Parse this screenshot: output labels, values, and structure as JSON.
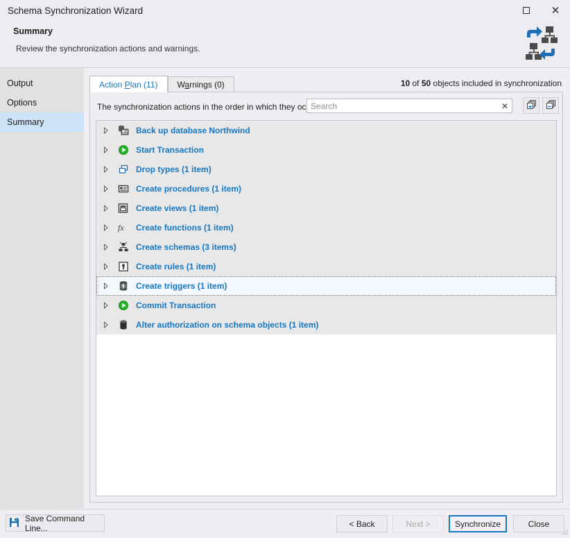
{
  "window": {
    "title": "Schema Synchronization Wizard",
    "maximize_label": "Maximize",
    "close_label": "✕"
  },
  "header": {
    "title": "Summary",
    "subtitle": "Review the synchronization actions and warnings.",
    "logo_name": "schema-sync-logo"
  },
  "sidebar": {
    "items": [
      {
        "label": "Output",
        "active": false
      },
      {
        "label": "Options",
        "active": false
      },
      {
        "label": "Summary",
        "active": true
      }
    ]
  },
  "tabs": [
    {
      "label": "Action Plan (11)",
      "accel_pre": "Action ",
      "accel": "P",
      "accel_post": "lan (11)",
      "active": true
    },
    {
      "label": "Warnings (0)",
      "accel_pre": "W",
      "accel": "a",
      "accel_post": "rnings (0)",
      "active": false
    }
  ],
  "summary_count": {
    "included": "10",
    "mid": " of ",
    "total": "50",
    "suffix": " objects included in synchronization"
  },
  "toolbar": {
    "description": "The synchronization actions in the order in which they occur.",
    "search_placeholder": "Search",
    "search_value": "",
    "clear_label": "✕",
    "expand_all_name": "expand-all-button",
    "collapse_all_name": "collapse-all-button"
  },
  "tree": {
    "rows": [
      {
        "label": "Back up database Northwind",
        "icon": "backup-database-icon",
        "focused": false
      },
      {
        "label": "Start Transaction",
        "icon": "play-green-icon",
        "focused": false
      },
      {
        "label": "Drop types (1 item)",
        "icon": "type-icon",
        "focused": false
      },
      {
        "label": "Create procedures (1 item)",
        "icon": "procedure-icon",
        "focused": false
      },
      {
        "label": "Create views (1 item)",
        "icon": "view-icon",
        "focused": false
      },
      {
        "label": "Create functions (1 item)",
        "icon": "function-fx-icon",
        "focused": false
      },
      {
        "label": "Create schemas (3 items)",
        "icon": "schema-tree-icon",
        "focused": false
      },
      {
        "label": "Create rules (1 item)",
        "icon": "rule-icon",
        "focused": false
      },
      {
        "label": "Create triggers (1 item)",
        "icon": "trigger-icon",
        "focused": true
      },
      {
        "label": "Commit Transaction",
        "icon": "play-green-icon",
        "focused": false
      },
      {
        "label": "Alter authorization on schema objects (1 item)",
        "icon": "database-icon",
        "focused": false
      }
    ]
  },
  "footer": {
    "save_command_line": "Save Command Line...",
    "back": "< Back",
    "next": "Next >",
    "synchronize": "Synchronize",
    "close": "Close"
  },
  "colors": {
    "accent_blue": "#1577c4",
    "link_blue": "#1f76bb",
    "selection_blue": "#cde3f7",
    "green": "#27a327",
    "row_gray": "#e8e8e8",
    "chrome": "#eeecf0"
  }
}
